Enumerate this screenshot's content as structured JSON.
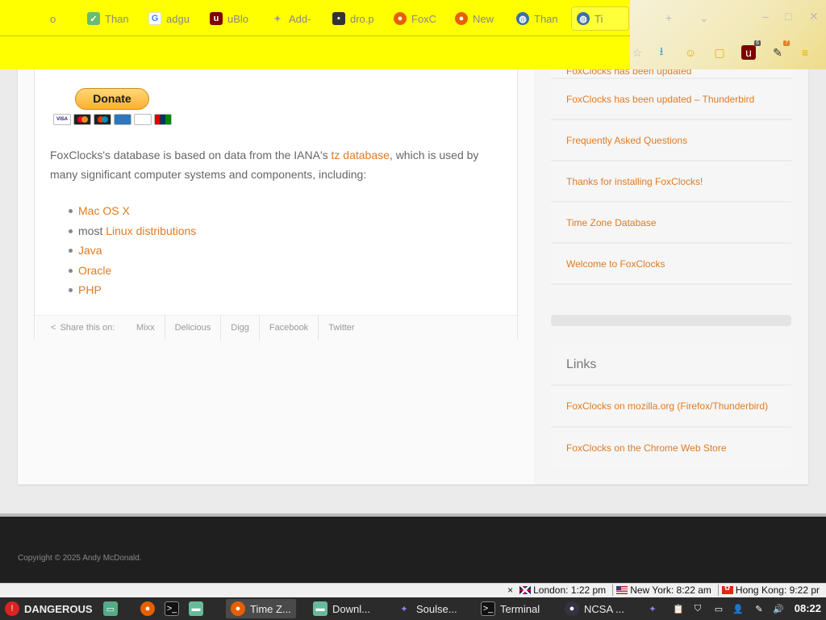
{
  "browser": {
    "tabs": [
      {
        "label": "o",
        "icon": "partial-icon"
      },
      {
        "label": "Than",
        "icon": "shield-check-icon"
      },
      {
        "label": "adgu",
        "icon": "google-icon"
      },
      {
        "label": "uBlo",
        "icon": "ublock-icon"
      },
      {
        "label": "Add-",
        "icon": "addon-icon"
      },
      {
        "label": "dro.p",
        "icon": "terminal-icon"
      },
      {
        "label": "FoxC",
        "icon": "firefox-icon"
      },
      {
        "label": "New",
        "icon": "firefox-icon"
      },
      {
        "label": "Than",
        "icon": "globe-icon"
      },
      {
        "label": "Ti",
        "icon": "globe-icon"
      }
    ],
    "toolbar_badges": {
      "ublock": "6",
      "extension": "7"
    }
  },
  "article": {
    "donate_label": "Donate",
    "cards": [
      "VISA",
      "MC",
      "MAESTRO",
      "AMEX",
      "DISCOVER",
      "UNIONPAY"
    ],
    "para_prefix": "FoxClocks's database is based on data from the IANA's ",
    "para_link": "tz database",
    "para_suffix": ", which is used by many significant computer systems and components, including:",
    "bullets": [
      {
        "prefix": "",
        "link": "Mac OS X"
      },
      {
        "prefix": "most ",
        "link": "Linux distributions"
      },
      {
        "prefix": "",
        "link": "Java"
      },
      {
        "prefix": "",
        "link": "Oracle"
      },
      {
        "prefix": "",
        "link": "PHP"
      }
    ],
    "share_label": "Share this on:",
    "share_items": [
      "Mixx",
      "Delicious",
      "Digg",
      "Facebook",
      "Twitter"
    ]
  },
  "sidebar": {
    "items": [
      "FoxClocks has been updated",
      "FoxClocks has been updated – Thunderbird",
      "Frequently Asked Questions",
      "Thanks for installing FoxClocks!",
      "Time Zone Database",
      "Welcome to FoxClocks"
    ],
    "links_title": "Links",
    "links": [
      "FoxClocks on mozilla.org (Firefox/Thunderbird)",
      "FoxClocks on the Chrome Web Store"
    ]
  },
  "footer": {
    "copyright": "Copyright © 2025 Andy McDonald."
  },
  "clocks": [
    {
      "label": "London: 1:22 pm",
      "flag": "uk"
    },
    {
      "label": "New York: 8:22 am",
      "flag": "us"
    },
    {
      "label": "Hong Kong: 9:22 pr",
      "flag": "hk"
    }
  ],
  "taskbar": {
    "start_label": "DANGEROUS",
    "windows": [
      "Time Z...",
      "Downl...",
      "Soulse...",
      "Terminal",
      "NCSA ..."
    ],
    "time": "08:22"
  }
}
